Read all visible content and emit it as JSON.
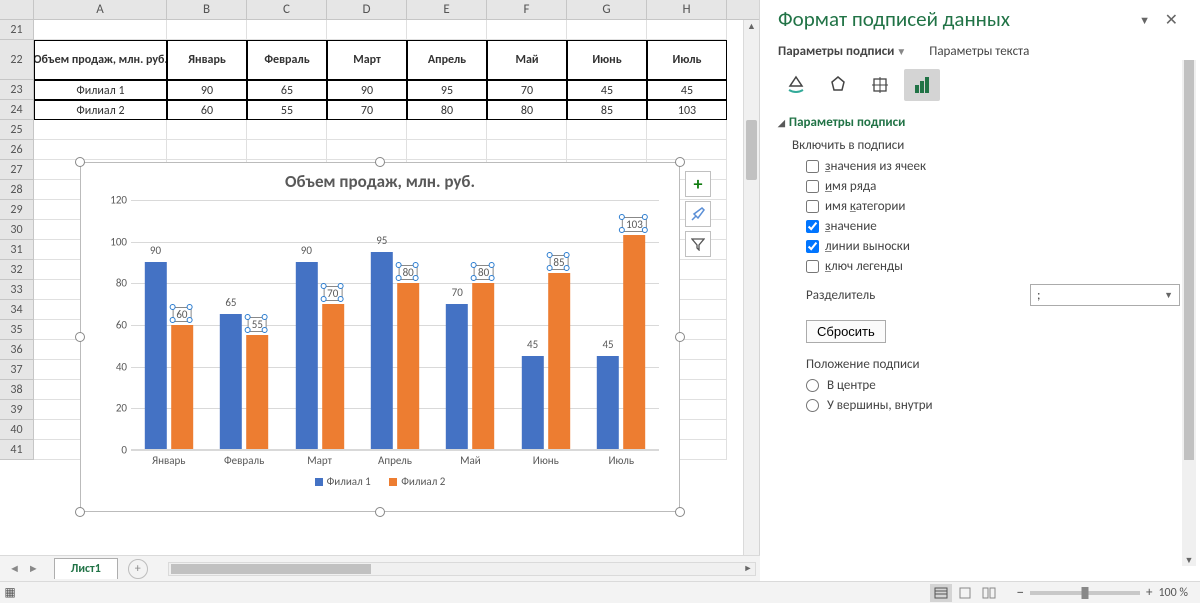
{
  "columns": [
    "A",
    "B",
    "C",
    "D",
    "E",
    "F",
    "G",
    "H"
  ],
  "rows_start": 21,
  "rows_end": 41,
  "table": {
    "header": [
      "Объем продаж, млн. руб.",
      "Январь",
      "Февраль",
      "Март",
      "Апрель",
      "Май",
      "Июнь",
      "Июль"
    ],
    "rows": [
      [
        "Филиал 1",
        "90",
        "65",
        "90",
        "95",
        "70",
        "45",
        "45"
      ],
      [
        "Филиал 2",
        "60",
        "55",
        "70",
        "80",
        "80",
        "85",
        "103"
      ]
    ]
  },
  "chart_data": {
    "type": "bar",
    "title": "Объем продаж, млн. руб.",
    "categories": [
      "Январь",
      "Февраль",
      "Март",
      "Апрель",
      "Май",
      "Июнь",
      "Июль"
    ],
    "series": [
      {
        "name": "Филиал 1",
        "values": [
          90,
          65,
          90,
          95,
          70,
          45,
          45
        ],
        "color": "#4472c4"
      },
      {
        "name": "Филиал 2",
        "values": [
          60,
          55,
          70,
          80,
          80,
          85,
          103
        ],
        "color": "#ed7d31"
      }
    ],
    "ylim": [
      0,
      120
    ],
    "ystep": 20,
    "xlabel": "",
    "ylabel": ""
  },
  "chart_buttons": {
    "add": "+",
    "brush": "brush",
    "filter": "filter"
  },
  "panel": {
    "title": "Формат подписей данных",
    "tab_options": "Параметры подписи",
    "tab_text": "Параметры текста",
    "section_header": "Параметры подписи",
    "include_label": "Включить в подписи",
    "cb_cells": "значения из ячеек",
    "cb_series": "имя ряда",
    "cb_category": "имя категории",
    "cb_value": "значение",
    "cb_leader": "линии выноски",
    "cb_legendkey": "ключ легенды",
    "separator_label": "Разделитель",
    "separator_value": ";",
    "reset": "Сбросить",
    "position_label": "Положение подписи",
    "radio_center": "В центре",
    "radio_insidetop": "У вершины, внутри"
  },
  "sheet_tab": "Лист1",
  "zoom": {
    "minus": "−",
    "plus": "+",
    "value": "100 %"
  }
}
